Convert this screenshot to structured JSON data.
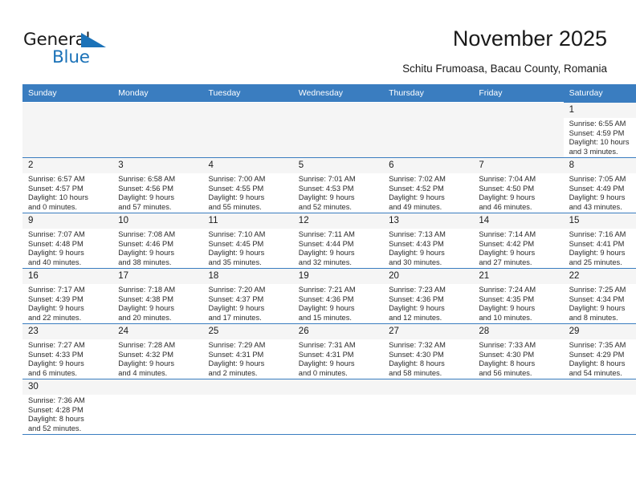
{
  "brand": {
    "name_part1": "General",
    "name_part2": "Blue",
    "flag_color": "#1b72b8"
  },
  "header": {
    "title": "November 2025",
    "subtitle": "Schitu Frumoasa, Bacau County, Romania"
  },
  "theme": {
    "header_bg": "#3a7dc0",
    "daynum_bg": "#f5f5f5",
    "border": "#3a7dc0",
    "text": "#1a1a1a"
  },
  "weekdays": [
    "Sunday",
    "Monday",
    "Tuesday",
    "Wednesday",
    "Thursday",
    "Friday",
    "Saturday"
  ],
  "labels": {
    "sunrise": "Sunrise:",
    "sunset": "Sunset:",
    "daylight": "Daylight:"
  },
  "weeks": [
    [
      {
        "day": "",
        "empty": true
      },
      {
        "day": "",
        "empty": true
      },
      {
        "day": "",
        "empty": true
      },
      {
        "day": "",
        "empty": true
      },
      {
        "day": "",
        "empty": true
      },
      {
        "day": "",
        "empty": true
      },
      {
        "day": "1",
        "sunrise": "Sunrise: 6:55 AM",
        "sunset": "Sunset: 4:59 PM",
        "daylight1": "Daylight: 10 hours",
        "daylight2": "and 3 minutes."
      }
    ],
    [
      {
        "day": "2",
        "sunrise": "Sunrise: 6:57 AM",
        "sunset": "Sunset: 4:57 PM",
        "daylight1": "Daylight: 10 hours",
        "daylight2": "and 0 minutes."
      },
      {
        "day": "3",
        "sunrise": "Sunrise: 6:58 AM",
        "sunset": "Sunset: 4:56 PM",
        "daylight1": "Daylight: 9 hours",
        "daylight2": "and 57 minutes."
      },
      {
        "day": "4",
        "sunrise": "Sunrise: 7:00 AM",
        "sunset": "Sunset: 4:55 PM",
        "daylight1": "Daylight: 9 hours",
        "daylight2": "and 55 minutes."
      },
      {
        "day": "5",
        "sunrise": "Sunrise: 7:01 AM",
        "sunset": "Sunset: 4:53 PM",
        "daylight1": "Daylight: 9 hours",
        "daylight2": "and 52 minutes."
      },
      {
        "day": "6",
        "sunrise": "Sunrise: 7:02 AM",
        "sunset": "Sunset: 4:52 PM",
        "daylight1": "Daylight: 9 hours",
        "daylight2": "and 49 minutes."
      },
      {
        "day": "7",
        "sunrise": "Sunrise: 7:04 AM",
        "sunset": "Sunset: 4:50 PM",
        "daylight1": "Daylight: 9 hours",
        "daylight2": "and 46 minutes."
      },
      {
        "day": "8",
        "sunrise": "Sunrise: 7:05 AM",
        "sunset": "Sunset: 4:49 PM",
        "daylight1": "Daylight: 9 hours",
        "daylight2": "and 43 minutes."
      }
    ],
    [
      {
        "day": "9",
        "sunrise": "Sunrise: 7:07 AM",
        "sunset": "Sunset: 4:48 PM",
        "daylight1": "Daylight: 9 hours",
        "daylight2": "and 40 minutes."
      },
      {
        "day": "10",
        "sunrise": "Sunrise: 7:08 AM",
        "sunset": "Sunset: 4:46 PM",
        "daylight1": "Daylight: 9 hours",
        "daylight2": "and 38 minutes."
      },
      {
        "day": "11",
        "sunrise": "Sunrise: 7:10 AM",
        "sunset": "Sunset: 4:45 PM",
        "daylight1": "Daylight: 9 hours",
        "daylight2": "and 35 minutes."
      },
      {
        "day": "12",
        "sunrise": "Sunrise: 7:11 AM",
        "sunset": "Sunset: 4:44 PM",
        "daylight1": "Daylight: 9 hours",
        "daylight2": "and 32 minutes."
      },
      {
        "day": "13",
        "sunrise": "Sunrise: 7:13 AM",
        "sunset": "Sunset: 4:43 PM",
        "daylight1": "Daylight: 9 hours",
        "daylight2": "and 30 minutes."
      },
      {
        "day": "14",
        "sunrise": "Sunrise: 7:14 AM",
        "sunset": "Sunset: 4:42 PM",
        "daylight1": "Daylight: 9 hours",
        "daylight2": "and 27 minutes."
      },
      {
        "day": "15",
        "sunrise": "Sunrise: 7:16 AM",
        "sunset": "Sunset: 4:41 PM",
        "daylight1": "Daylight: 9 hours",
        "daylight2": "and 25 minutes."
      }
    ],
    [
      {
        "day": "16",
        "sunrise": "Sunrise: 7:17 AM",
        "sunset": "Sunset: 4:39 PM",
        "daylight1": "Daylight: 9 hours",
        "daylight2": "and 22 minutes."
      },
      {
        "day": "17",
        "sunrise": "Sunrise: 7:18 AM",
        "sunset": "Sunset: 4:38 PM",
        "daylight1": "Daylight: 9 hours",
        "daylight2": "and 20 minutes."
      },
      {
        "day": "18",
        "sunrise": "Sunrise: 7:20 AM",
        "sunset": "Sunset: 4:37 PM",
        "daylight1": "Daylight: 9 hours",
        "daylight2": "and 17 minutes."
      },
      {
        "day": "19",
        "sunrise": "Sunrise: 7:21 AM",
        "sunset": "Sunset: 4:36 PM",
        "daylight1": "Daylight: 9 hours",
        "daylight2": "and 15 minutes."
      },
      {
        "day": "20",
        "sunrise": "Sunrise: 7:23 AM",
        "sunset": "Sunset: 4:36 PM",
        "daylight1": "Daylight: 9 hours",
        "daylight2": "and 12 minutes."
      },
      {
        "day": "21",
        "sunrise": "Sunrise: 7:24 AM",
        "sunset": "Sunset: 4:35 PM",
        "daylight1": "Daylight: 9 hours",
        "daylight2": "and 10 minutes."
      },
      {
        "day": "22",
        "sunrise": "Sunrise: 7:25 AM",
        "sunset": "Sunset: 4:34 PM",
        "daylight1": "Daylight: 9 hours",
        "daylight2": "and 8 minutes."
      }
    ],
    [
      {
        "day": "23",
        "sunrise": "Sunrise: 7:27 AM",
        "sunset": "Sunset: 4:33 PM",
        "daylight1": "Daylight: 9 hours",
        "daylight2": "and 6 minutes."
      },
      {
        "day": "24",
        "sunrise": "Sunrise: 7:28 AM",
        "sunset": "Sunset: 4:32 PM",
        "daylight1": "Daylight: 9 hours",
        "daylight2": "and 4 minutes."
      },
      {
        "day": "25",
        "sunrise": "Sunrise: 7:29 AM",
        "sunset": "Sunset: 4:31 PM",
        "daylight1": "Daylight: 9 hours",
        "daylight2": "and 2 minutes."
      },
      {
        "day": "26",
        "sunrise": "Sunrise: 7:31 AM",
        "sunset": "Sunset: 4:31 PM",
        "daylight1": "Daylight: 9 hours",
        "daylight2": "and 0 minutes."
      },
      {
        "day": "27",
        "sunrise": "Sunrise: 7:32 AM",
        "sunset": "Sunset: 4:30 PM",
        "daylight1": "Daylight: 8 hours",
        "daylight2": "and 58 minutes."
      },
      {
        "day": "28",
        "sunrise": "Sunrise: 7:33 AM",
        "sunset": "Sunset: 4:30 PM",
        "daylight1": "Daylight: 8 hours",
        "daylight2": "and 56 minutes."
      },
      {
        "day": "29",
        "sunrise": "Sunrise: 7:35 AM",
        "sunset": "Sunset: 4:29 PM",
        "daylight1": "Daylight: 8 hours",
        "daylight2": "and 54 minutes."
      }
    ],
    [
      {
        "day": "30",
        "sunrise": "Sunrise: 7:36 AM",
        "sunset": "Sunset: 4:28 PM",
        "daylight1": "Daylight: 8 hours",
        "daylight2": "and 52 minutes."
      },
      {
        "day": "",
        "blank": true
      },
      {
        "day": "",
        "blank": true
      },
      {
        "day": "",
        "blank": true
      },
      {
        "day": "",
        "blank": true
      },
      {
        "day": "",
        "blank": true
      },
      {
        "day": "",
        "blank": true
      }
    ]
  ]
}
